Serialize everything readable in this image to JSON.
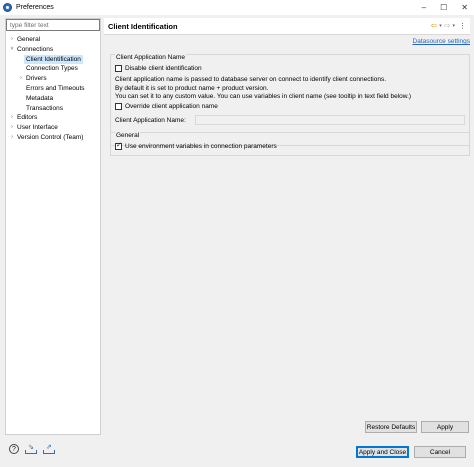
{
  "window": {
    "title": "Preferences",
    "controls": [
      "–",
      "☐",
      "✕"
    ]
  },
  "filter": {
    "placeholder": "type filter text"
  },
  "tree": [
    {
      "label": "General",
      "indent": 0,
      "twisty": "›"
    },
    {
      "label": "Connections",
      "indent": 0,
      "twisty": "˅"
    },
    {
      "label": "Client Identification",
      "indent": 1,
      "twisty": "",
      "selected": true
    },
    {
      "label": "Connection Types",
      "indent": 1,
      "twisty": ""
    },
    {
      "label": "Drivers",
      "indent": 1,
      "twisty": "›"
    },
    {
      "label": "Errors and Timeouts",
      "indent": 1,
      "twisty": ""
    },
    {
      "label": "Metadata",
      "indent": 1,
      "twisty": ""
    },
    {
      "label": "Transactions",
      "indent": 1,
      "twisty": ""
    },
    {
      "label": "Editors",
      "indent": 0,
      "twisty": "›"
    },
    {
      "label": "User Interface",
      "indent": 0,
      "twisty": "›"
    },
    {
      "label": "Version Control (Team)",
      "indent": 0,
      "twisty": "›"
    }
  ],
  "page": {
    "title": "Client Identification",
    "datasource_link": "Datasource settings",
    "nav": {
      "back": "⇦",
      "forward": "⇨",
      "dropdown": "▾",
      "menu": "⋮"
    }
  },
  "client_group": {
    "title": "Client Application Name",
    "disable_label": "Disable client identification",
    "disable_checked": false,
    "desc_line1": "Client application name is passed to database server on connect to identify client connections.",
    "desc_line2": "By default it is set to product name + product version.",
    "desc_line3": "You can set it to any custom value. You can use variables in client name (see tooltip in text field below.)",
    "override_label": "Override client application name",
    "override_checked": false,
    "name_label": "Client Application Name:",
    "name_value": ""
  },
  "general_group": {
    "title": "General",
    "env_label": "Use environment variables in connection parameters",
    "env_checked": true
  },
  "buttons": {
    "restore_defaults": "Restore Defaults",
    "apply": "Apply",
    "apply_close": "Apply and Close",
    "cancel": "Cancel"
  },
  "bottom_icons": [
    "help-icon",
    "import-icon",
    "export-icon"
  ]
}
